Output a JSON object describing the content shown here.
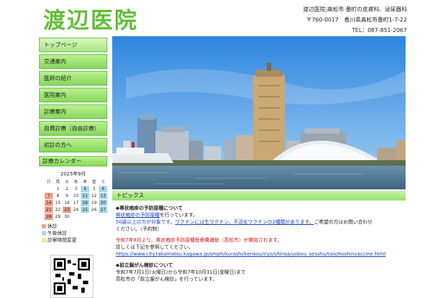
{
  "header": {
    "logo": "渡辺医院",
    "info1": "渡辺医院",
    "sep": "|",
    "info2": "高松市 番町の皮膚科、泌尿器科",
    "postal": "〒760-0017　香川県高松市番町1-7-22",
    "tel": "TEL：087-851-2067"
  },
  "nav": [
    {
      "label": "トップページ"
    },
    {
      "label": "交通案内"
    },
    {
      "label": "医師の紹介"
    },
    {
      "label": "医院案内"
    },
    {
      "label": "診療案内"
    },
    {
      "label": "自費診療（自由診療）"
    },
    {
      "label": "初診の方へ"
    }
  ],
  "calendar": {
    "title": "診療カレンダー",
    "month": "2025年9月",
    "weekdays": [
      "日",
      "月",
      "火",
      "水",
      "木",
      "金",
      "土"
    ],
    "rows": [
      [
        "",
        "1",
        "2",
        "3",
        "4",
        "5",
        "6"
      ],
      [
        "7",
        "8",
        "9",
        "10",
        "11",
        "12",
        "13"
      ],
      [
        "14",
        "15",
        "16",
        "17",
        "18",
        "19",
        "20"
      ],
      [
        "21",
        "22",
        "23",
        "24",
        "25",
        "26",
        "27"
      ],
      [
        "28",
        "29",
        "30",
        "",
        "",
        "",
        ""
      ]
    ],
    "legend": {
      "rest": "休診",
      "pm": "午後休診",
      "chg": "診察時間変更"
    },
    "colors": {
      "rest": "#f2a08a",
      "pm": "#a8d8e8",
      "chg": "#f5e68a"
    }
  },
  "topics": {
    "title": "トピックス",
    "t1_title": "◆帯状疱疹の予防接種について",
    "t1_link": "帯状疱疹の予防接種",
    "t1_after": "を行っています。",
    "t1_line2": "50歳以上の方が対象です。",
    "t1_line2b": "ワクチンには生ワクチン、不活化ワクチンの2種類があります。",
    "t1_line2c": "ご希望の方はお問い合わせ",
    "t1_line3": "ください。（予約制）",
    "t2_red": "令和7年8月より、帯状疱疹予防接種医療費補助（高松市）が開始されます。",
    "t2_line": "詳しくは下記を参照してください。",
    "t2_url": "https://www.city.takamatsu.kagawa.jp/smph/kurashi/kenkou/iryo/shinsa/yobou_sesshu/taijohoshinvaccine.html",
    "t3_title": "◆前立腺がん検診について",
    "t3_line1": "令和7年7月1日(火曜日)から令和7年10月31日(金曜日)まで",
    "t3_line2": "高松市の「前立腺がん検診」を行っています。"
  },
  "colors": {
    "brand": "#5fbf35",
    "nav": "#86d85a",
    "link": "#1a3fc4",
    "alert": "#d11111"
  }
}
